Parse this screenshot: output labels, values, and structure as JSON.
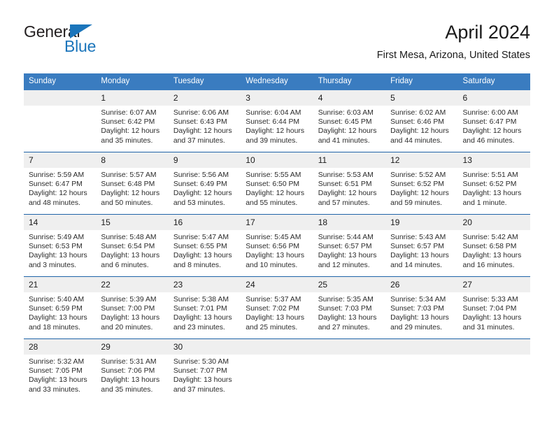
{
  "logo": {
    "general_text": "General",
    "blue_text": "Blue",
    "accent_color": "#1b75bb"
  },
  "header": {
    "title": "April 2024",
    "subtitle": "First Mesa, Arizona, United States"
  },
  "theme": {
    "header_row_color": "#3a7cc0",
    "week_divider_color": "#1f64a8",
    "daynum_band_color": "#efefef"
  },
  "labels": {
    "sunrise_prefix": "Sunrise:",
    "sunset_prefix": "Sunset:",
    "daylight_prefix": "Daylight:"
  },
  "weekdays": [
    "Sunday",
    "Monday",
    "Tuesday",
    "Wednesday",
    "Thursday",
    "Friday",
    "Saturday"
  ],
  "weeks": [
    [
      {
        "day": "",
        "sunrise": "",
        "sunset": "",
        "daylight": "",
        "empty": true
      },
      {
        "day": "1",
        "sunrise": "Sunrise: 6:07 AM",
        "sunset": "Sunset: 6:42 PM",
        "daylight": "Daylight: 12 hours and 35 minutes."
      },
      {
        "day": "2",
        "sunrise": "Sunrise: 6:06 AM",
        "sunset": "Sunset: 6:43 PM",
        "daylight": "Daylight: 12 hours and 37 minutes."
      },
      {
        "day": "3",
        "sunrise": "Sunrise: 6:04 AM",
        "sunset": "Sunset: 6:44 PM",
        "daylight": "Daylight: 12 hours and 39 minutes."
      },
      {
        "day": "4",
        "sunrise": "Sunrise: 6:03 AM",
        "sunset": "Sunset: 6:45 PM",
        "daylight": "Daylight: 12 hours and 41 minutes."
      },
      {
        "day": "5",
        "sunrise": "Sunrise: 6:02 AM",
        "sunset": "Sunset: 6:46 PM",
        "daylight": "Daylight: 12 hours and 44 minutes."
      },
      {
        "day": "6",
        "sunrise": "Sunrise: 6:00 AM",
        "sunset": "Sunset: 6:47 PM",
        "daylight": "Daylight: 12 hours and 46 minutes."
      }
    ],
    [
      {
        "day": "7",
        "sunrise": "Sunrise: 5:59 AM",
        "sunset": "Sunset: 6:47 PM",
        "daylight": "Daylight: 12 hours and 48 minutes."
      },
      {
        "day": "8",
        "sunrise": "Sunrise: 5:57 AM",
        "sunset": "Sunset: 6:48 PM",
        "daylight": "Daylight: 12 hours and 50 minutes."
      },
      {
        "day": "9",
        "sunrise": "Sunrise: 5:56 AM",
        "sunset": "Sunset: 6:49 PM",
        "daylight": "Daylight: 12 hours and 53 minutes."
      },
      {
        "day": "10",
        "sunrise": "Sunrise: 5:55 AM",
        "sunset": "Sunset: 6:50 PM",
        "daylight": "Daylight: 12 hours and 55 minutes."
      },
      {
        "day": "11",
        "sunrise": "Sunrise: 5:53 AM",
        "sunset": "Sunset: 6:51 PM",
        "daylight": "Daylight: 12 hours and 57 minutes."
      },
      {
        "day": "12",
        "sunrise": "Sunrise: 5:52 AM",
        "sunset": "Sunset: 6:52 PM",
        "daylight": "Daylight: 12 hours and 59 minutes."
      },
      {
        "day": "13",
        "sunrise": "Sunrise: 5:51 AM",
        "sunset": "Sunset: 6:52 PM",
        "daylight": "Daylight: 13 hours and 1 minute."
      }
    ],
    [
      {
        "day": "14",
        "sunrise": "Sunrise: 5:49 AM",
        "sunset": "Sunset: 6:53 PM",
        "daylight": "Daylight: 13 hours and 3 minutes."
      },
      {
        "day": "15",
        "sunrise": "Sunrise: 5:48 AM",
        "sunset": "Sunset: 6:54 PM",
        "daylight": "Daylight: 13 hours and 6 minutes."
      },
      {
        "day": "16",
        "sunrise": "Sunrise: 5:47 AM",
        "sunset": "Sunset: 6:55 PM",
        "daylight": "Daylight: 13 hours and 8 minutes."
      },
      {
        "day": "17",
        "sunrise": "Sunrise: 5:45 AM",
        "sunset": "Sunset: 6:56 PM",
        "daylight": "Daylight: 13 hours and 10 minutes."
      },
      {
        "day": "18",
        "sunrise": "Sunrise: 5:44 AM",
        "sunset": "Sunset: 6:57 PM",
        "daylight": "Daylight: 13 hours and 12 minutes."
      },
      {
        "day": "19",
        "sunrise": "Sunrise: 5:43 AM",
        "sunset": "Sunset: 6:57 PM",
        "daylight": "Daylight: 13 hours and 14 minutes."
      },
      {
        "day": "20",
        "sunrise": "Sunrise: 5:42 AM",
        "sunset": "Sunset: 6:58 PM",
        "daylight": "Daylight: 13 hours and 16 minutes."
      }
    ],
    [
      {
        "day": "21",
        "sunrise": "Sunrise: 5:40 AM",
        "sunset": "Sunset: 6:59 PM",
        "daylight": "Daylight: 13 hours and 18 minutes."
      },
      {
        "day": "22",
        "sunrise": "Sunrise: 5:39 AM",
        "sunset": "Sunset: 7:00 PM",
        "daylight": "Daylight: 13 hours and 20 minutes."
      },
      {
        "day": "23",
        "sunrise": "Sunrise: 5:38 AM",
        "sunset": "Sunset: 7:01 PM",
        "daylight": "Daylight: 13 hours and 23 minutes."
      },
      {
        "day": "24",
        "sunrise": "Sunrise: 5:37 AM",
        "sunset": "Sunset: 7:02 PM",
        "daylight": "Daylight: 13 hours and 25 minutes."
      },
      {
        "day": "25",
        "sunrise": "Sunrise: 5:35 AM",
        "sunset": "Sunset: 7:03 PM",
        "daylight": "Daylight: 13 hours and 27 minutes."
      },
      {
        "day": "26",
        "sunrise": "Sunrise: 5:34 AM",
        "sunset": "Sunset: 7:03 PM",
        "daylight": "Daylight: 13 hours and 29 minutes."
      },
      {
        "day": "27",
        "sunrise": "Sunrise: 5:33 AM",
        "sunset": "Sunset: 7:04 PM",
        "daylight": "Daylight: 13 hours and 31 minutes."
      }
    ],
    [
      {
        "day": "28",
        "sunrise": "Sunrise: 5:32 AM",
        "sunset": "Sunset: 7:05 PM",
        "daylight": "Daylight: 13 hours and 33 minutes."
      },
      {
        "day": "29",
        "sunrise": "Sunrise: 5:31 AM",
        "sunset": "Sunset: 7:06 PM",
        "daylight": "Daylight: 13 hours and 35 minutes."
      },
      {
        "day": "30",
        "sunrise": "Sunrise: 5:30 AM",
        "sunset": "Sunset: 7:07 PM",
        "daylight": "Daylight: 13 hours and 37 minutes."
      },
      {
        "day": "",
        "sunrise": "",
        "sunset": "",
        "daylight": "",
        "empty": true
      },
      {
        "day": "",
        "sunrise": "",
        "sunset": "",
        "daylight": "",
        "empty": true
      },
      {
        "day": "",
        "sunrise": "",
        "sunset": "",
        "daylight": "",
        "empty": true
      },
      {
        "day": "",
        "sunrise": "",
        "sunset": "",
        "daylight": "",
        "empty": true
      }
    ]
  ]
}
